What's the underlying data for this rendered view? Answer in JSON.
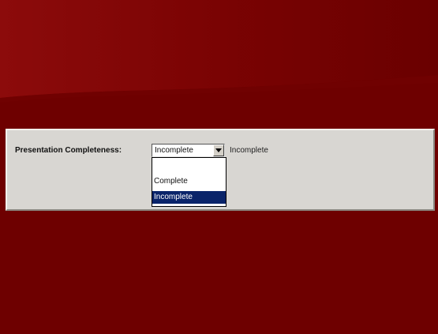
{
  "form": {
    "field_label": "Presentation Completeness:",
    "select": {
      "selected_value": "Incomplete",
      "options": [
        "",
        "Complete",
        "Incomplete"
      ],
      "highlighted_option": "Incomplete"
    },
    "status_text": "Incomplete"
  },
  "colors": {
    "background": "#6e0000",
    "panel": "#d8d6d2",
    "selection": "#0a246a"
  },
  "icons": {
    "dropdown_arrow": "chevron-down-icon"
  }
}
